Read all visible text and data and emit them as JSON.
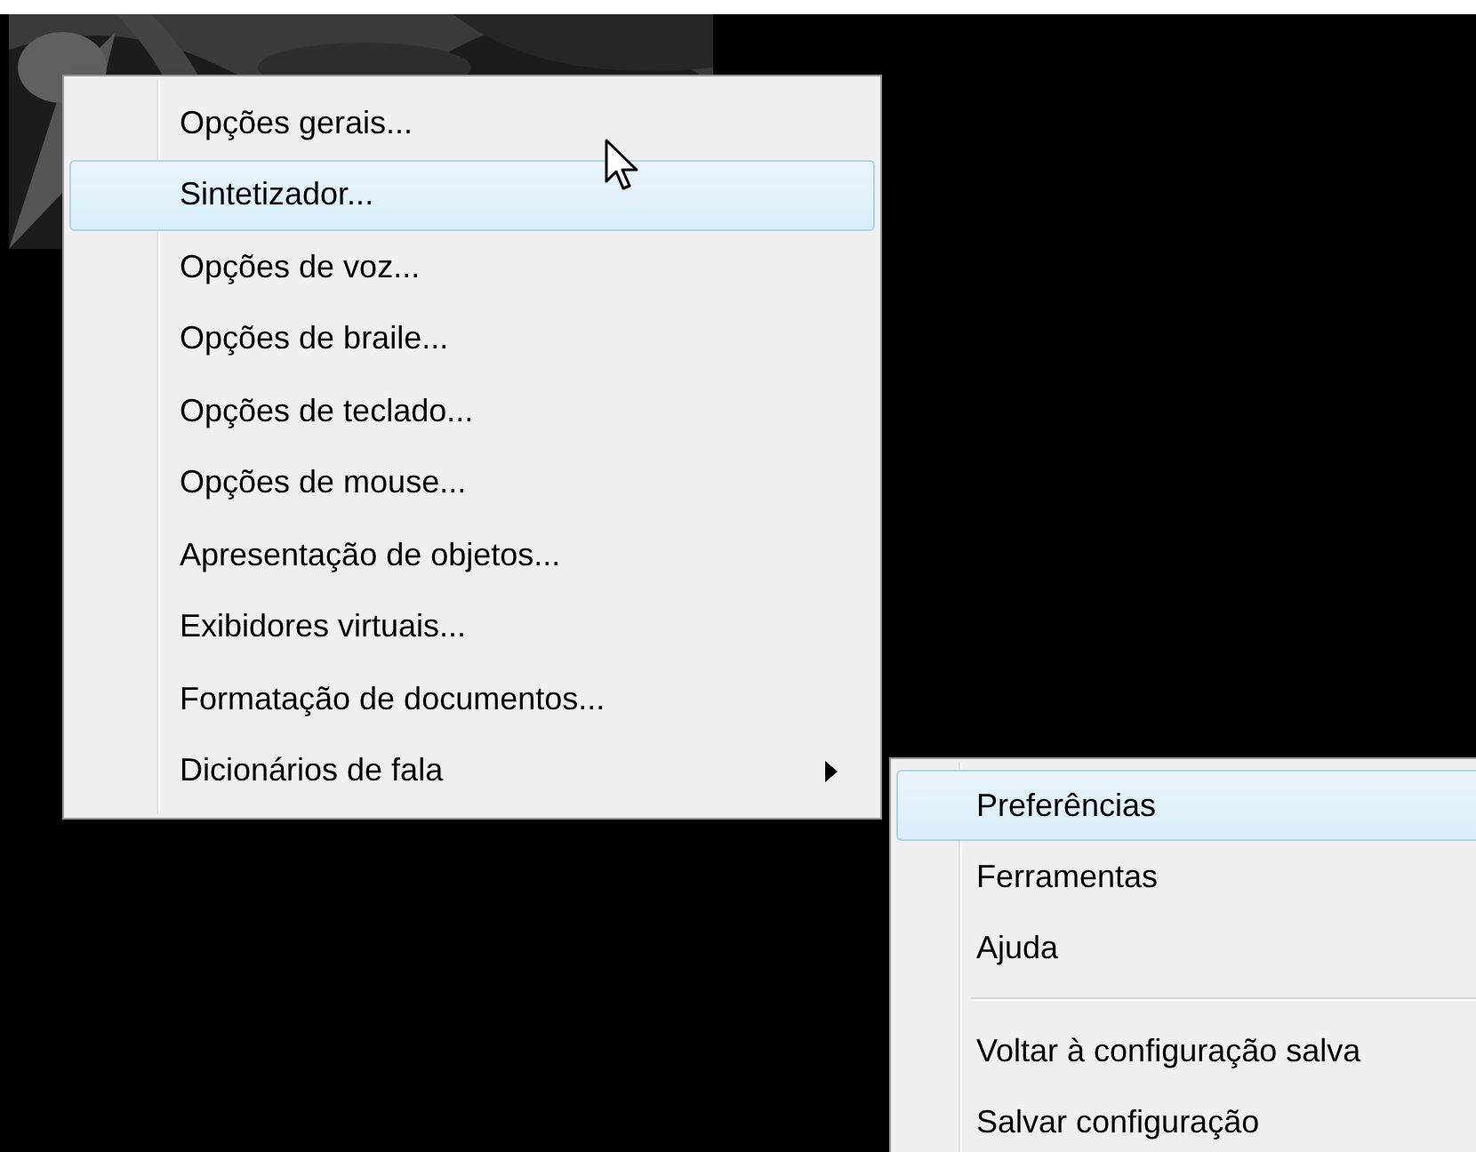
{
  "menu": {
    "items": [
      {
        "kind": "item",
        "label": "Opções gerais...",
        "selected": false,
        "has_submenu": false
      },
      {
        "kind": "item",
        "label": "Sintetizador...",
        "selected": true,
        "has_submenu": false
      },
      {
        "kind": "item",
        "label": "Opções de voz...",
        "selected": false,
        "has_submenu": false
      },
      {
        "kind": "item",
        "label": "Opções de braile...",
        "selected": false,
        "has_submenu": false
      },
      {
        "kind": "item",
        "label": "Opções de teclado...",
        "selected": false,
        "has_submenu": false
      },
      {
        "kind": "item",
        "label": "Opções de mouse...",
        "selected": false,
        "has_submenu": false
      },
      {
        "kind": "item",
        "label": "Apresentação de objetos...",
        "selected": false,
        "has_submenu": false
      },
      {
        "kind": "item",
        "label": "Exibidores virtuais...",
        "selected": false,
        "has_submenu": false
      },
      {
        "kind": "item",
        "label": "Formatação de documentos...",
        "selected": false,
        "has_submenu": false
      },
      {
        "kind": "item",
        "label": "Dicionários de fala",
        "selected": false,
        "has_submenu": true
      }
    ]
  },
  "submenu": {
    "items": [
      {
        "kind": "item",
        "label": "Preferências",
        "selected": true
      },
      {
        "kind": "item",
        "label": "Ferramentas",
        "selected": false
      },
      {
        "kind": "item",
        "label": "Ajuda",
        "selected": false
      },
      {
        "kind": "separator"
      },
      {
        "kind": "item",
        "label": "Voltar à configuração salva",
        "selected": false
      },
      {
        "kind": "item",
        "label": "Salvar configuração",
        "selected": false
      }
    ]
  }
}
